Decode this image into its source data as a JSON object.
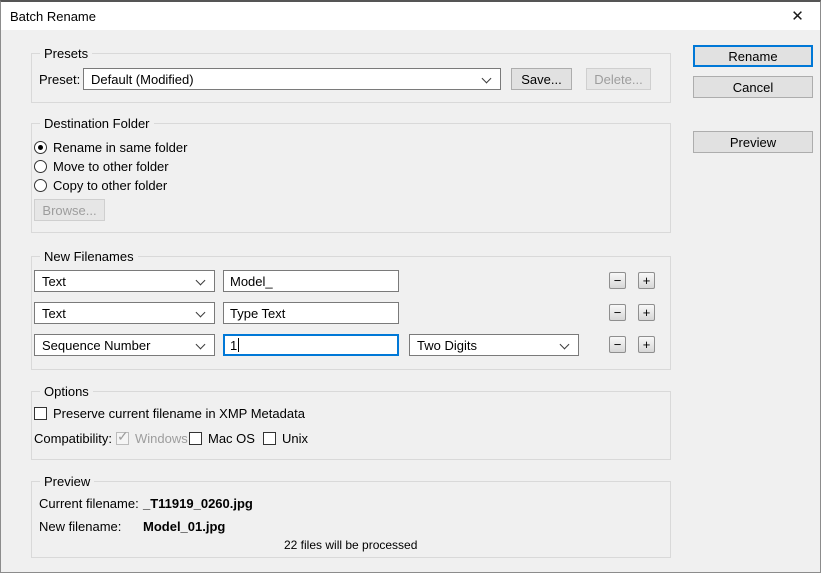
{
  "window": {
    "title": "Batch Rename"
  },
  "icons": {
    "close": "✕",
    "minus": "−",
    "plus": "+",
    "check": "✓"
  },
  "actions": {
    "rename": "Rename",
    "cancel": "Cancel",
    "preview": "Preview"
  },
  "presets": {
    "group_label": "Presets",
    "preset_label": "Preset:",
    "preset_value": "Default (Modified)",
    "save_label": "Save...",
    "delete_label": "Delete..."
  },
  "destination": {
    "group_label": "Destination Folder",
    "options": [
      "Rename in same folder",
      "Move to other folder",
      "Copy to other folder"
    ],
    "selected": "Rename in same folder",
    "browse_label": "Browse..."
  },
  "new_filenames": {
    "group_label": "New Filenames",
    "rows": [
      {
        "type": "Text",
        "value": "Model_"
      },
      {
        "type": "Text",
        "value": "Type Text"
      },
      {
        "type": "Sequence Number",
        "value": "1",
        "digits": "Two Digits"
      }
    ]
  },
  "options": {
    "group_label": "Options",
    "preserve_label": "Preserve current filename in XMP Metadata",
    "preserve_checked": false,
    "compatibility_label": "Compatibility:",
    "systems": [
      {
        "label": "Windows",
        "checked": true,
        "disabled": true
      },
      {
        "label": "Mac OS",
        "checked": false,
        "disabled": false
      },
      {
        "label": "Unix",
        "checked": false,
        "disabled": false
      }
    ]
  },
  "preview": {
    "group_label": "Preview",
    "current_label": "Current filename:",
    "current_value": "_T11919_0260.jpg",
    "new_label": "New filename:",
    "new_value": "Model_01.jpg",
    "status": "22 files will be processed"
  },
  "colors": {
    "accent": "#0078d7",
    "dialog_bg": "#f0f0f0",
    "titlebar_bg": "#ffffff",
    "disabled_text": "#9d9d9d"
  }
}
